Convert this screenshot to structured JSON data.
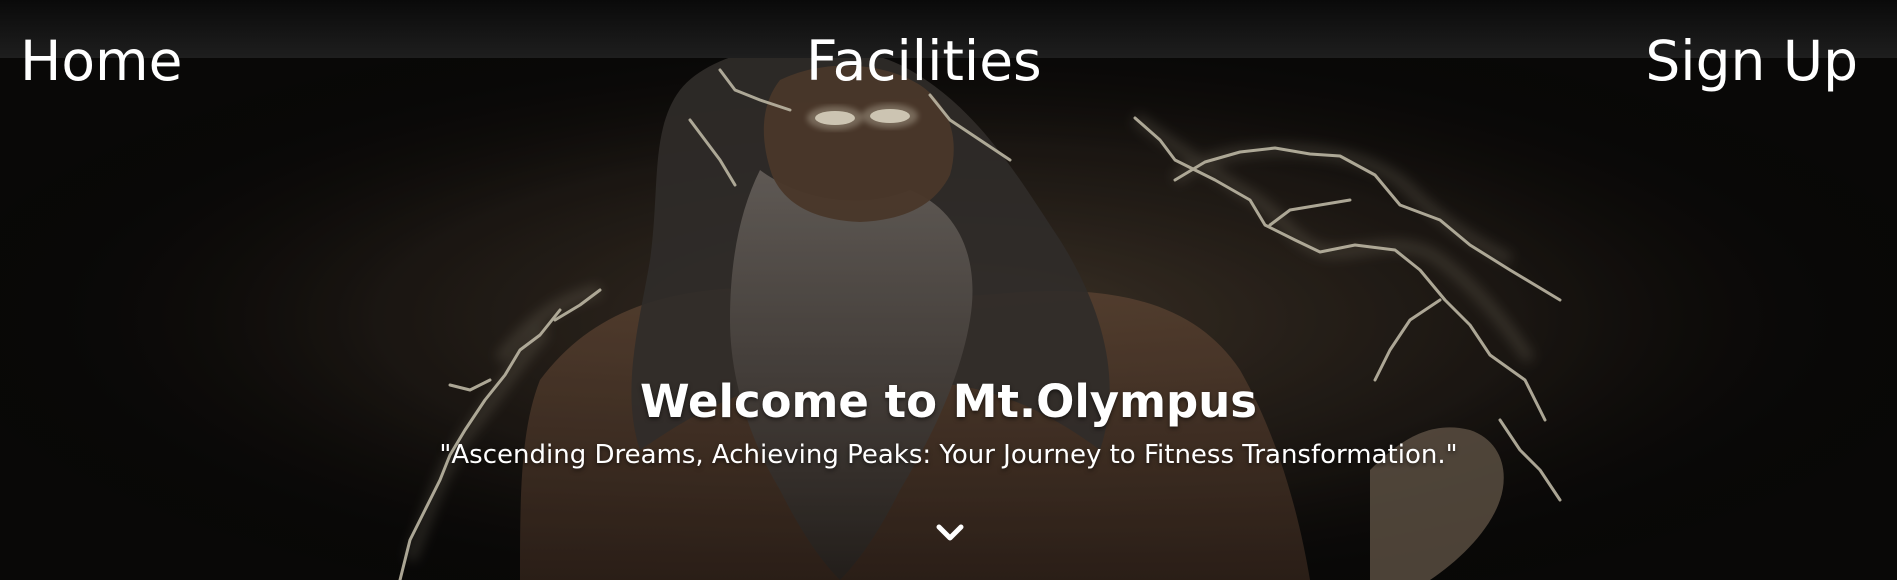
{
  "nav": {
    "home": "Home",
    "facilities": "Facilities",
    "signup": "Sign Up"
  },
  "hero": {
    "title": "Welcome to Mt.Olympus",
    "subtitle": "\"Ascending Dreams, Achieving Peaks: Your Journey to Fitness Transformation.\"",
    "background_image": "zeus-with-lightning",
    "scroll_icon": "chevron-down-icon"
  },
  "colors": {
    "text": "#ffffff",
    "background": "#0b0b0b",
    "topbar": "#1e1e1e",
    "lightning": "#d8cfb4"
  }
}
